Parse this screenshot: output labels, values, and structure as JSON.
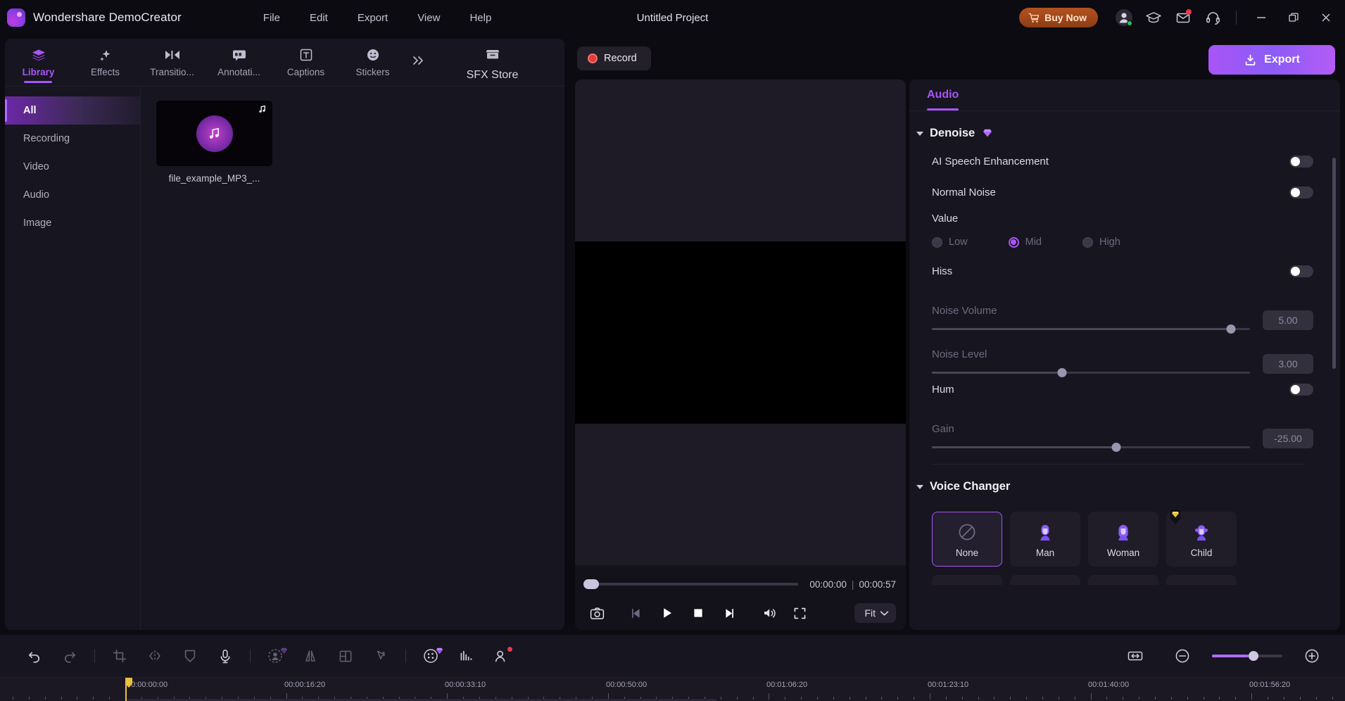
{
  "app": {
    "brand": "Wondershare DemoCreator",
    "project_title": "Untitled Project",
    "logo_icon": "democreator-logo-icon"
  },
  "menubar": [
    {
      "label": "File"
    },
    {
      "label": "Edit"
    },
    {
      "label": "Export"
    },
    {
      "label": "View"
    },
    {
      "label": "Help"
    }
  ],
  "titlebar_right": {
    "buy_now": "Buy Now",
    "cart_icon": "cart-icon",
    "account_icon": "account-icon",
    "tutorial_icon": "graduation-cap-icon",
    "inbox_icon": "mail-icon",
    "support_icon": "headset-icon",
    "minimize_icon": "minimize-icon",
    "restore_icon": "restore-icon",
    "close_icon": "close-icon"
  },
  "left_panel": {
    "tabs": [
      {
        "label": "Library",
        "icon": "layers-icon",
        "active": true
      },
      {
        "label": "Effects",
        "icon": "sparkles-icon",
        "active": false
      },
      {
        "label": "Transitio...",
        "icon": "transition-icon",
        "active": false
      },
      {
        "label": "Annotati...",
        "icon": "annotation-icon",
        "active": false
      },
      {
        "label": "Captions",
        "icon": "text-box-icon",
        "active": false
      },
      {
        "label": "Stickers",
        "icon": "smiley-icon",
        "active": false
      }
    ],
    "more_icon": "chevron-double-right-icon",
    "sfx_tab": {
      "label": "SFX Store",
      "icon": "store-icon"
    },
    "categories": [
      {
        "label": "All",
        "active": true
      },
      {
        "label": "Recording",
        "active": false
      },
      {
        "label": "Video",
        "active": false
      },
      {
        "label": "Audio",
        "active": false
      },
      {
        "label": "Image",
        "active": false
      }
    ],
    "media_items": [
      {
        "name": "file_example_MP3_...",
        "type_icon": "music-note-icon"
      }
    ],
    "add_media_label": "+",
    "add_media_icon": "plus-icon"
  },
  "center": {
    "record_label": "Record",
    "record_icon": "record-dot-icon",
    "export_label": "Export",
    "export_icon": "export-icon",
    "current_time": "00:00:00",
    "total_time": "00:00:57",
    "time_separator": "|",
    "controls": [
      {
        "name": "snapshot-button",
        "icon": "camera-icon"
      },
      {
        "name": "prev-frame-button",
        "icon": "step-backward-icon"
      },
      {
        "name": "play-button",
        "icon": "play-icon"
      },
      {
        "name": "stop-button",
        "icon": "stop-icon"
      },
      {
        "name": "next-frame-button",
        "icon": "step-forward-icon"
      },
      {
        "name": "volume-button",
        "icon": "speaker-icon"
      },
      {
        "name": "fullscreen-button",
        "icon": "fullscreen-icon"
      }
    ],
    "fit_label": "Fit",
    "fit_caret_icon": "chevron-down-icon"
  },
  "right_panel": {
    "tab": "Audio",
    "denoise": {
      "title": "Denoise",
      "premium_icon": "diamond-icon",
      "ai_speech": {
        "label": "AI Speech Enhancement",
        "on": false
      },
      "normal_noise": {
        "label": "Normal Noise",
        "on": false
      },
      "value_label": "Value",
      "value_options": [
        {
          "label": "Low",
          "selected": false
        },
        {
          "label": "Mid",
          "selected": true
        },
        {
          "label": "High",
          "selected": false
        }
      ],
      "hiss": {
        "label": "Hiss",
        "on": false
      },
      "noise_volume": {
        "label": "Noise Volume",
        "value": "5.00",
        "pct": 94
      },
      "noise_level": {
        "label": "Noise Level",
        "value": "3.00",
        "pct": 41
      },
      "hum": {
        "label": "Hum",
        "on": false
      },
      "gain": {
        "label": "Gain",
        "value": "-25.00",
        "pct": 58
      }
    },
    "voice_changer": {
      "title": "Voice Changer",
      "options": [
        {
          "label": "None",
          "icon": "no-entry-icon",
          "selected": true,
          "premium": false
        },
        {
          "label": "Man",
          "icon": "man-avatar-icon",
          "selected": false,
          "premium": false
        },
        {
          "label": "Woman",
          "icon": "woman-avatar-icon",
          "selected": false,
          "premium": false
        },
        {
          "label": "Child",
          "icon": "child-avatar-icon",
          "selected": false,
          "premium": true
        }
      ]
    }
  },
  "bottom_toolbar": {
    "tools": [
      {
        "name": "undo-button",
        "icon": "undo-icon",
        "disabled": false,
        "badge": "none"
      },
      {
        "name": "redo-button",
        "icon": "redo-icon",
        "disabled": true,
        "badge": "none"
      },
      {
        "name": "crop-button",
        "icon": "crop-icon",
        "disabled": true,
        "badge": "none"
      },
      {
        "name": "split-button",
        "icon": "split-icon",
        "disabled": true,
        "badge": "none"
      },
      {
        "name": "marker-button",
        "icon": "shield-icon",
        "disabled": true,
        "badge": "none"
      },
      {
        "name": "voiceover-button",
        "icon": "microphone-icon",
        "disabled": false,
        "badge": "none"
      },
      {
        "name": "ai-portrait-button",
        "icon": "ai-person-icon",
        "disabled": true,
        "badge": "gem"
      },
      {
        "name": "mirror-button",
        "icon": "mirror-icon",
        "disabled": true,
        "badge": "none"
      },
      {
        "name": "crop-pan-button",
        "icon": "grid-frame-icon",
        "disabled": true,
        "badge": "none"
      },
      {
        "name": "cursor-effect-button",
        "icon": "cursor-sparkle-icon",
        "disabled": true,
        "badge": "none"
      },
      {
        "name": "color-match-button",
        "icon": "palette-icon",
        "disabled": false,
        "badge": "gem"
      },
      {
        "name": "auto-subtitle-button",
        "icon": "subtitle-icon",
        "disabled": false,
        "badge": "none"
      },
      {
        "name": "avatar-presenter-button",
        "icon": "avatar-icon",
        "disabled": false,
        "badge": "red"
      }
    ],
    "fit_timeline_icon": "fit-timeline-icon",
    "zoom_out_icon": "zoom-out-icon",
    "zoom_in_icon": "zoom-in-icon",
    "zoom_pct": 52
  },
  "timeline": {
    "playhead_time": "00:00:00:00",
    "ruler_labels": [
      "00:00:00:00",
      "00:00:16:20",
      "00:00:33:10",
      "00:00:50:00",
      "00:01:06:20",
      "00:01:23:10",
      "00:01:40:00",
      "00:01:56:20"
    ]
  },
  "colors": {
    "accent_purple": "#a855f7",
    "buy_now_orange": "#b3521f",
    "record_red": "#e23b3b",
    "playhead_yellow": "#e8c33c",
    "panel_bg": "#17151f",
    "app_bg": "#0c0b11"
  }
}
